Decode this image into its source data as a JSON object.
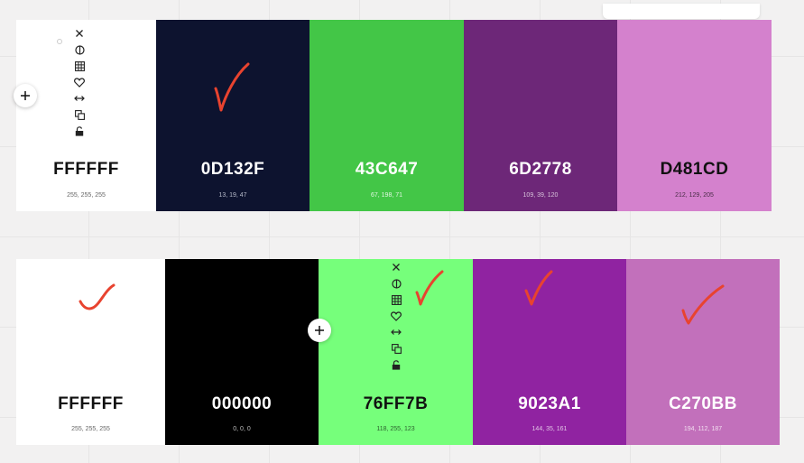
{
  "palettes": [
    {
      "swatches": [
        {
          "hex": "FFFFFF",
          "rgb": "255, 255, 255",
          "color": "#FFFFFF",
          "text_color": "#111111",
          "sub_color": "#666666",
          "checked": false
        },
        {
          "hex": "0D132F",
          "rgb": "13, 19, 47",
          "color": "#0D132F",
          "text_color": "#FFFFFF",
          "sub_color": "#B8BCCB",
          "checked": true
        },
        {
          "hex": "43C647",
          "rgb": "67, 198, 71",
          "color": "#43C647",
          "text_color": "#FFFFFF",
          "sub_color": "#E2F6E2",
          "checked": false
        },
        {
          "hex": "6D2778",
          "rgb": "109, 39, 120",
          "color": "#6D2778",
          "text_color": "#FFFFFF",
          "sub_color": "#D8C4DB",
          "checked": false
        },
        {
          "hex": "D481CD",
          "rgb": "212, 129, 205",
          "color": "#D481CD",
          "text_color": "#111111",
          "sub_color": "#4A2D47",
          "checked": false
        }
      ]
    },
    {
      "swatches": [
        {
          "hex": "FFFFFF",
          "rgb": "255, 255, 255",
          "color": "#FFFFFF",
          "text_color": "#111111",
          "sub_color": "#666666",
          "checked": true
        },
        {
          "hex": "000000",
          "rgb": "0, 0, 0",
          "color": "#000000",
          "text_color": "#FFFFFF",
          "sub_color": "#BBBBBB",
          "checked": false
        },
        {
          "hex": "76FF7B",
          "rgb": "118, 255, 123",
          "color": "#76FF7B",
          "text_color": "#111111",
          "sub_color": "#2E6430",
          "checked": true
        },
        {
          "hex": "9023A1",
          "rgb": "144, 35, 161",
          "color": "#9023A1",
          "text_color": "#FFFFFF",
          "sub_color": "#E0C4E4",
          "checked": true
        },
        {
          "hex": "C270BB",
          "rgb": "194, 112, 187",
          "color": "#C270BB",
          "text_color": "#FFFFFF",
          "sub_color": "#F1DDEF",
          "checked": true
        }
      ]
    }
  ],
  "toolbar_icons": [
    "close-icon",
    "contrast-icon",
    "grid-icon",
    "heart-icon",
    "swap-icon",
    "copy-icon",
    "lock-icon"
  ],
  "accent_color": "#E8432F"
}
